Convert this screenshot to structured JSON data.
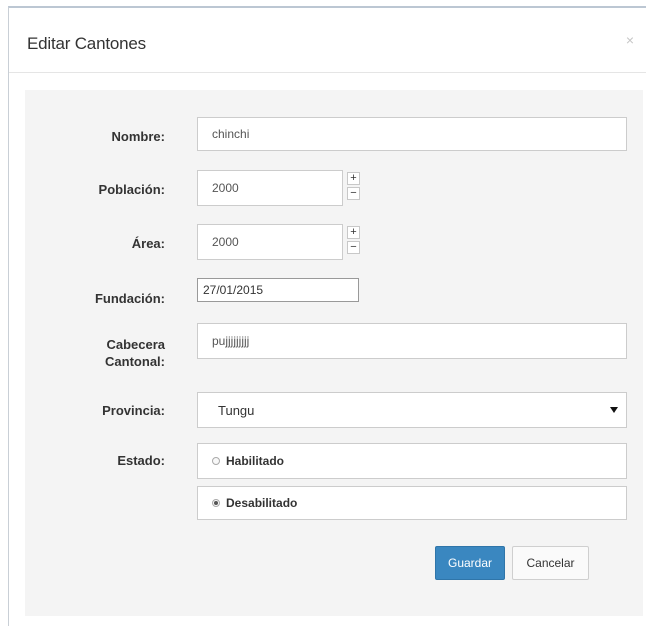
{
  "modal": {
    "title": "Editar Cantones",
    "close_symbol": "×"
  },
  "form": {
    "nombre": {
      "label": "Nombre:",
      "value": "chinchi"
    },
    "poblacion": {
      "label": "Población:",
      "value": "2000",
      "inc": "+",
      "dec": "−"
    },
    "area": {
      "label": "Área:",
      "value": "2000",
      "inc": "+",
      "dec": "−"
    },
    "fundacion": {
      "label": "Fundación:",
      "value": "27/01/2015"
    },
    "cabecera": {
      "label_line1": "Cabecera",
      "label_line2": "Cantonal:",
      "value": "pujjjjjjjjj"
    },
    "provincia": {
      "label": "Provincia:",
      "selected": "Tungu"
    },
    "estado": {
      "label": "Estado:",
      "options": [
        {
          "label": "Habilitado",
          "checked": false
        },
        {
          "label": "Desabilitado",
          "checked": true
        }
      ]
    }
  },
  "actions": {
    "save_label": "Guardar",
    "cancel_label": "Cancelar"
  },
  "colors": {
    "primary": "#3a87c0",
    "panel_bg": "#f4f4f4"
  }
}
